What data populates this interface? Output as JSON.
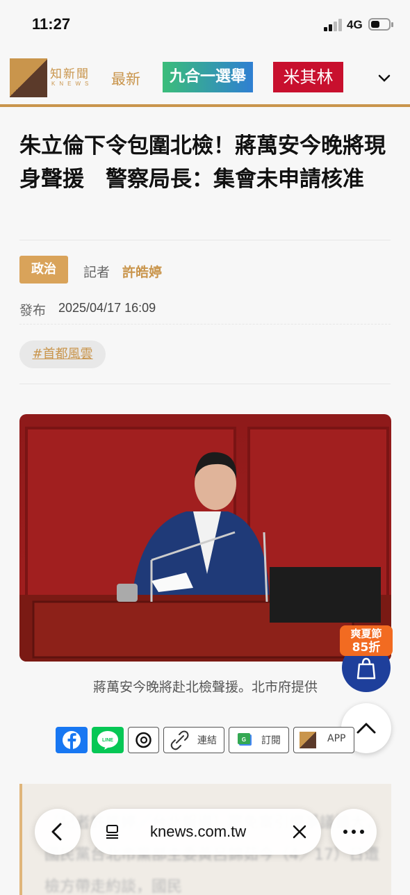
{
  "status_bar": {
    "time": "11:27",
    "network": "4G"
  },
  "nav": {
    "logo_text": "知新聞",
    "logo_sub": "KNEWS",
    "latest": "最新",
    "election": "九合一選舉",
    "michelin": "米其林"
  },
  "article": {
    "title": "朱立倫下令包圍北檢！蔣萬安今晚將現身聲援　警察局長：集會未申請核准",
    "category": "政治",
    "reporter_label": "記者",
    "reporter_name": "許皓婷",
    "publish_label": "發布",
    "publish_date": "2025/04/17 16:09",
    "tag": "#首都風雲",
    "photo_caption": "蔣萬安今晚將赴北檢聲援。北市府提供",
    "quote_text": "〔記者許皓婷／台北報導〕罷免案引爆爭議擴大，國民黨台北市黨部主委黃呂錦茹今（4／17）日遭檢方帶走約談，國民"
  },
  "share": {
    "link_label": "連結",
    "subscribe_label": "訂閱",
    "app_label": "APP"
  },
  "promo": {
    "line1": "爽夏節",
    "line2": "85折"
  },
  "browser": {
    "url": "knews.com.tw"
  },
  "colors": {
    "accent": "#c9954c",
    "cart": "#1e3f9b",
    "promo": "#f26b21",
    "michelin": "#c8102e"
  }
}
